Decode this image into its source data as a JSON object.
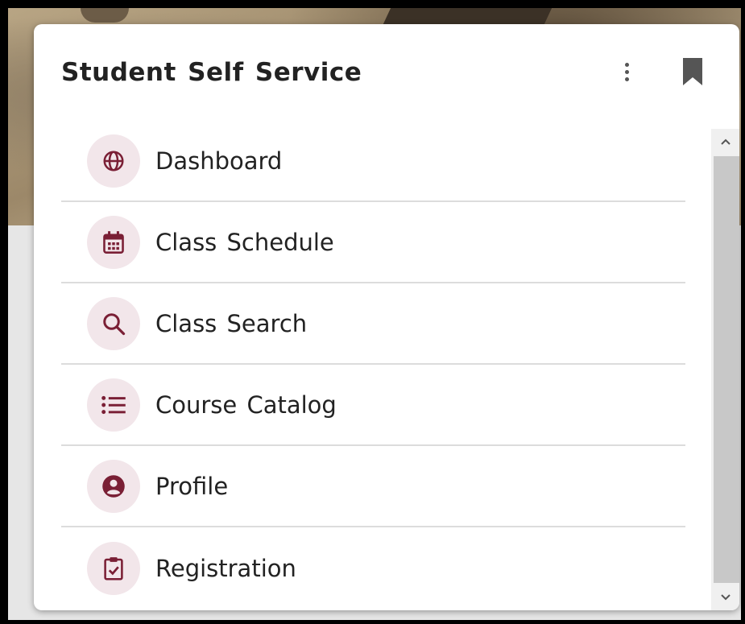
{
  "card": {
    "title": "Student Self Service"
  },
  "colors": {
    "accent": "#7a1f35",
    "icon_bg": "#f2e6ea"
  },
  "menu": [
    {
      "label": "Dashboard",
      "icon": "globe-icon"
    },
    {
      "label": "Class Schedule",
      "icon": "calendar-icon"
    },
    {
      "label": "Class Search",
      "icon": "search-icon"
    },
    {
      "label": "Course Catalog",
      "icon": "list-icon"
    },
    {
      "label": "Profile",
      "icon": "profile-icon"
    },
    {
      "label": "Registration",
      "icon": "clipboard-check-icon"
    }
  ]
}
